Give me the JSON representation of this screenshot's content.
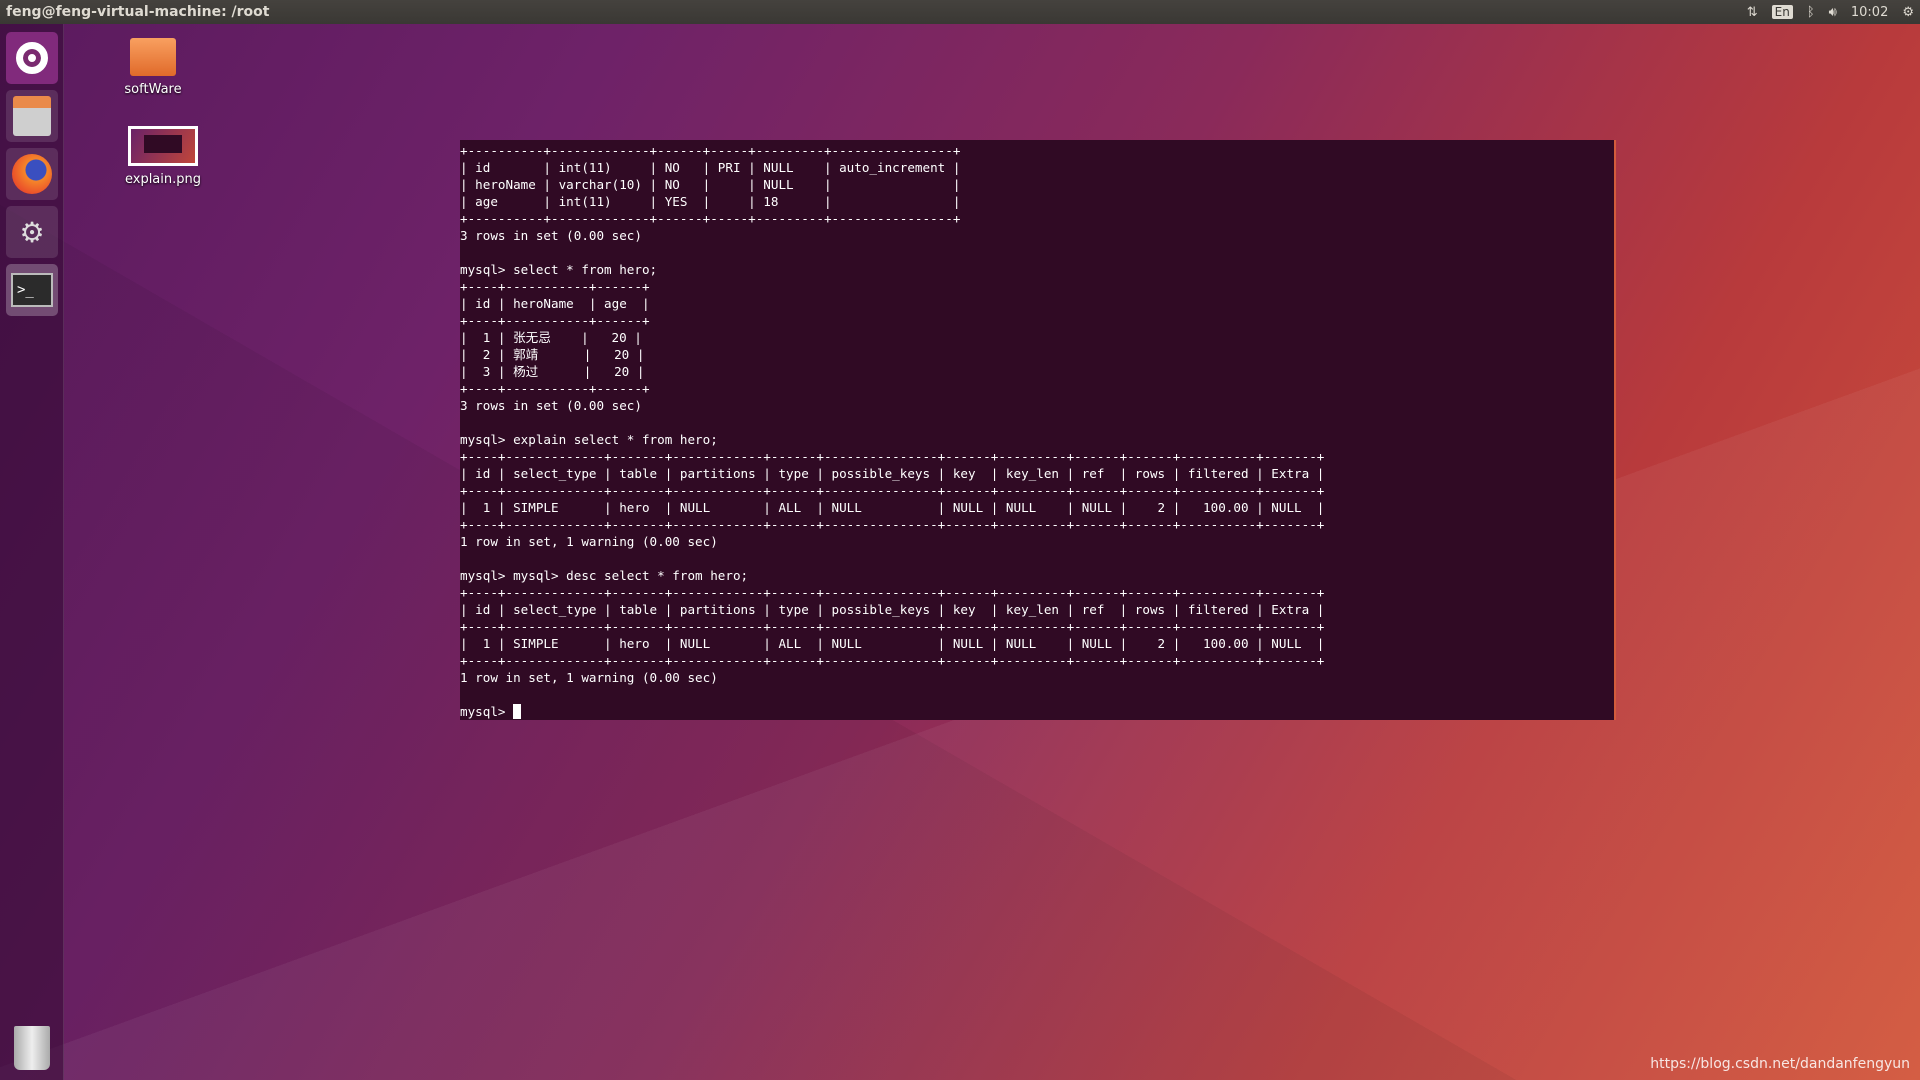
{
  "topbar": {
    "title": "feng@feng-virtual-machine: /root",
    "lang": "En",
    "clock": "10:02"
  },
  "launcher": {
    "items": [
      "ubuntu-dash",
      "files",
      "firefox",
      "system-settings",
      "terminal",
      "trash"
    ]
  },
  "desktop": {
    "icons": [
      {
        "label": "softWare",
        "icon": "folder-icon"
      },
      {
        "label": "explain.png",
        "icon": "image-icon"
      }
    ]
  },
  "terminal": {
    "lines": [
      "+----------+-------------+------+-----+---------+----------------+",
      "| id       | int(11)     | NO   | PRI | NULL    | auto_increment |",
      "| heroName | varchar(10) | NO   |     | NULL    |                |",
      "| age      | int(11)     | YES  |     | 18      |                |",
      "+----------+-------------+------+-----+---------+----------------+",
      "3 rows in set (0.00 sec)",
      "",
      "mysql> select * from hero;",
      "+----+-----------+------+",
      "| id | heroName  | age  |",
      "+----+-----------+------+",
      "|  1 | 张无忌    |   20 |",
      "|  2 | 郭靖      |   20 |",
      "|  3 | 杨过      |   20 |",
      "+----+-----------+------+",
      "3 rows in set (0.00 sec)",
      "",
      "mysql> explain select * from hero;",
      "+----+-------------+-------+------------+------+---------------+------+---------+------+------+----------+-------+",
      "| id | select_type | table | partitions | type | possible_keys | key  | key_len | ref  | rows | filtered | Extra |",
      "+----+-------------+-------+------------+------+---------------+------+---------+------+------+----------+-------+",
      "|  1 | SIMPLE      | hero  | NULL       | ALL  | NULL          | NULL | NULL    | NULL |    2 |   100.00 | NULL  |",
      "+----+-------------+-------+------------+------+---------------+------+---------+------+------+----------+-------+",
      "1 row in set, 1 warning (0.00 sec)",
      "",
      "mysql> mysql> desc select * from hero;",
      "+----+-------------+-------+------------+------+---------------+------+---------+------+------+----------+-------+",
      "| id | select_type | table | partitions | type | possible_keys | key  | key_len | ref  | rows | filtered | Extra |",
      "+----+-------------+-------+------------+------+---------------+------+---------+------+------+----------+-------+",
      "|  1 | SIMPLE      | hero  | NULL       | ALL  | NULL          | NULL | NULL    | NULL |    2 |   100.00 | NULL  |",
      "+----+-------------+-------+------------+------+---------------+------+---------+------+------+----------+-------+",
      "1 row in set, 1 warning (0.00 sec)",
      ""
    ],
    "prompt": "mysql> "
  },
  "watermark": "https://blog.csdn.net/dandanfengyun"
}
